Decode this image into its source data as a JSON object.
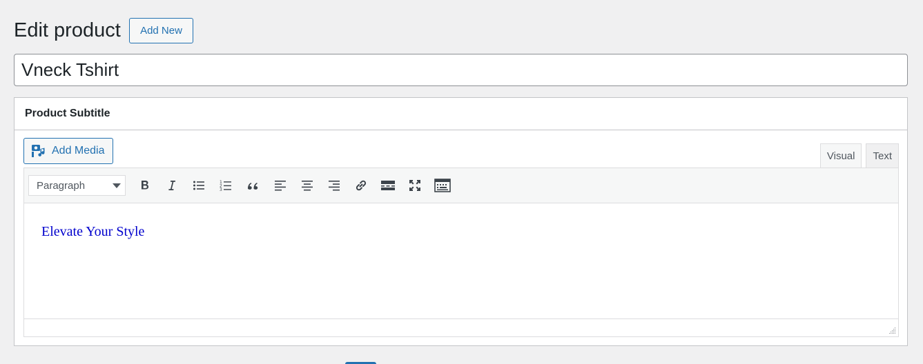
{
  "page": {
    "title": "Edit product",
    "add_new_label": "Add New"
  },
  "post_title": {
    "value": "Vneck Tshirt"
  },
  "subtitle_box": {
    "heading": "Product Subtitle",
    "add_media_label": "Add Media",
    "add_media_icon": "add-media-icon",
    "tabs": [
      {
        "label": "Visual",
        "active": true
      },
      {
        "label": "Text",
        "active": false
      }
    ],
    "format_select": {
      "selected": "Paragraph"
    },
    "toolbar_buttons": [
      "bold-icon",
      "italic-icon",
      "bulleted-list-icon",
      "numbered-list-icon",
      "blockquote-icon",
      "align-left-icon",
      "align-center-icon",
      "align-right-icon",
      "link-icon",
      "read-more-icon",
      "fullscreen-icon",
      "toolbar-toggle-icon"
    ],
    "content": "Elevate Your Style",
    "content_color": "#0000cd"
  },
  "colors": {
    "accent": "#2271b1",
    "background": "#f0f0f1",
    "border": "#c3c4c7"
  }
}
